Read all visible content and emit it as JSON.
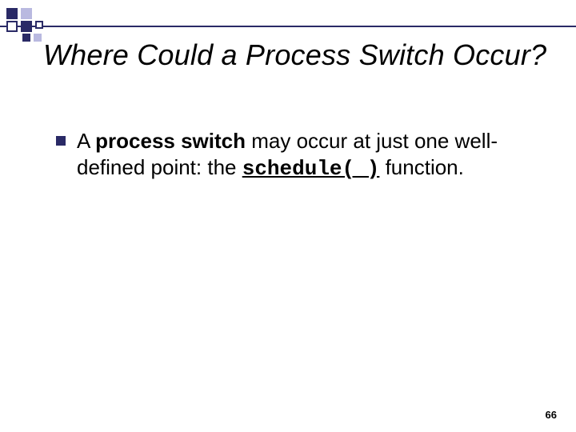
{
  "slide": {
    "title": "Where Could a Process Switch Occur?",
    "bullet": {
      "pre": "A ",
      "bold": "process switch",
      "mid": " may occur at just one well-defined point: the ",
      "code": "schedule( )",
      "post": " function."
    },
    "page_number": "66"
  }
}
